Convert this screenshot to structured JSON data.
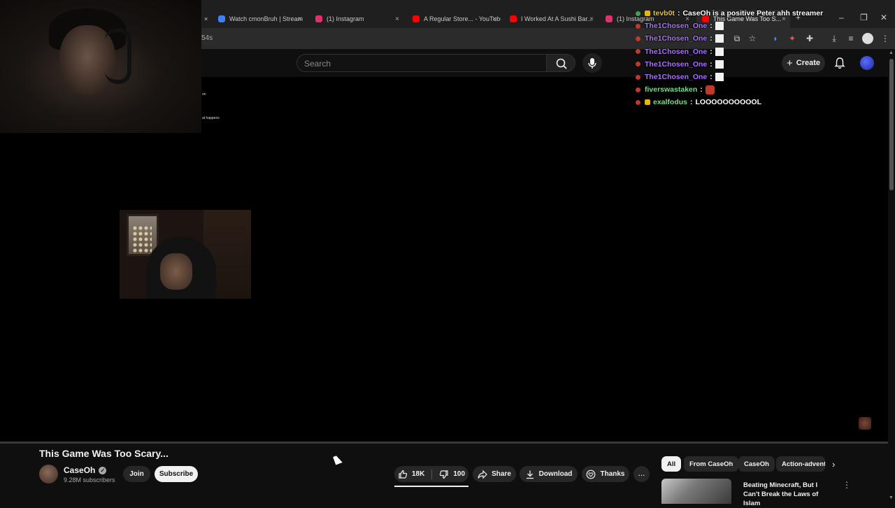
{
  "browser": {
    "tabs": [
      {
        "title": "Watch cmonBruh | Stream",
        "favicon_color": "#3b82f6"
      },
      {
        "title": "(1) Instagram",
        "favicon_color": "#e1306c"
      },
      {
        "title": "A Regular Store... - YouTube",
        "favicon_color": "#ff0000"
      },
      {
        "title": "I Worked At A Sushi Bar...",
        "favicon_color": "#ff0000"
      },
      {
        "title": "(1) Instagram",
        "favicon_color": "#e1306c"
      },
      {
        "title": "This Game Was Too S...",
        "favicon_color": "#ff0000"
      }
    ],
    "address_fragment": "54s"
  },
  "youtube_header": {
    "search_placeholder": "Search",
    "create_label": "Create"
  },
  "player": {
    "tiny_overlay_text_1": "on",
    "tiny_overlay_text_2": "at happens"
  },
  "chat": {
    "messages": [
      {
        "user": "tevb0t",
        "user_color": "#e6c24a",
        "text": "CaseOh is a positive Peter ahh streamer",
        "emote": "none"
      },
      {
        "user": "The1Chosen_One",
        "user_color": "#a970ff",
        "text": "",
        "emote": "white-box"
      },
      {
        "user": "The1Chosen_One",
        "user_color": "#a970ff",
        "text": "",
        "emote": "white-box"
      },
      {
        "user": "The1Chosen_One",
        "user_color": "#a970ff",
        "text": "",
        "emote": "white-box"
      },
      {
        "user": "The1Chosen_One",
        "user_color": "#a970ff",
        "text": "",
        "emote": "white-box"
      },
      {
        "user": "The1Chosen_One",
        "user_color": "#a970ff",
        "text": "",
        "emote": "white-box"
      },
      {
        "user": "fiverswastaken",
        "user_color": "#7bd88f",
        "text": "",
        "emote": "red-face"
      },
      {
        "user": "exalfodus",
        "user_color": "#7bd88f",
        "text": "LOOOOOOOOOOL",
        "emote": "none"
      }
    ]
  },
  "video": {
    "title": "This Game Was Too Scary...",
    "channel_name": "CaseOh",
    "subscribers": "9.28M subscribers",
    "join_label": "Join",
    "subscribe_label": "Subscribe",
    "likes": "18K",
    "dislikes": "100",
    "share_label": "Share",
    "download_label": "Download",
    "thanks_label": "Thanks",
    "more_label": "..."
  },
  "chips": [
    "All",
    "From CaseOh",
    "CaseOh",
    "Action-adventure"
  ],
  "recommendation": {
    "title": "Beating Minecraft, But I Can't Break the Laws of Islam"
  }
}
